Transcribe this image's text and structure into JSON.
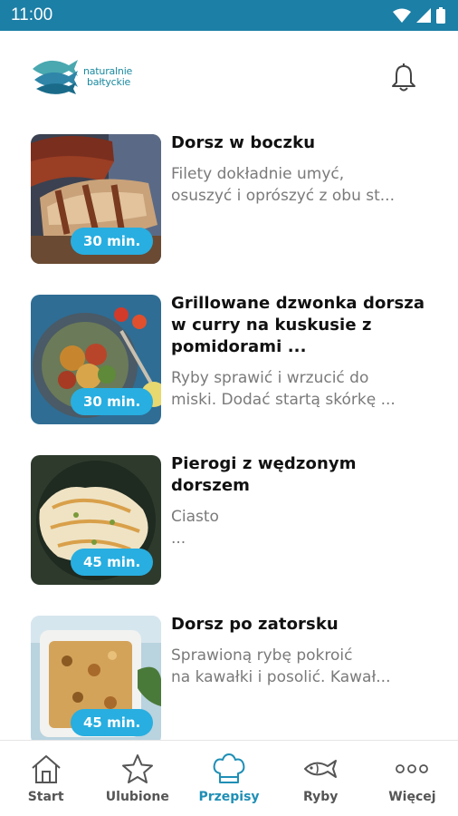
{
  "status_bar": {
    "time": "11:00"
  },
  "header": {
    "logo_line1": "naturalnie",
    "logo_line2": "bałtyckie"
  },
  "recipes": [
    {
      "title": "Dorsz w boczku",
      "description": "Filety dokładnie umyć,\nosuszyć i oprószyć z obu st...",
      "time": "30 min."
    },
    {
      "title": "Grillowane dzwonka dorsza w curry na kuskusie z pomidorami ...",
      "description": "Ryby  sprawić i wrzucić do\nmiski. Dodać startą skórkę ...",
      "time": "30 min."
    },
    {
      "title": "Pierogi z wędzonym dorszem",
      "description": "Ciasto\n...",
      "time": "45 min."
    },
    {
      "title": "Dorsz po zatorsku",
      "description": "Sprawioną rybę pokroić\nna kawałki i posolić. Kawał...",
      "time": "45 min."
    }
  ],
  "bottom_nav": [
    {
      "label": "Start",
      "icon": "home-icon"
    },
    {
      "label": "Ulubione",
      "icon": "star-icon"
    },
    {
      "label": "Przepisy",
      "icon": "chef-hat-icon",
      "active": true
    },
    {
      "label": "Ryby",
      "icon": "fish-icon"
    },
    {
      "label": "Więcej",
      "icon": "more-dots-icon"
    }
  ],
  "colors": {
    "status_bar": "#1c7fa6",
    "accent": "#1f8fb6",
    "badge": "#28aee0",
    "text_muted": "#7a7a7a"
  }
}
